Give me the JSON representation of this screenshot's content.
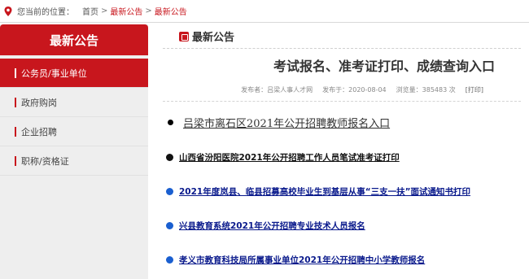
{
  "breadcrumb": {
    "lead": "您当前的位置：",
    "items": [
      "首页",
      "最新公告",
      "最新公告"
    ],
    "separator": ">"
  },
  "sidebar": {
    "title": "最新公告",
    "items": [
      {
        "label": "公务员/事业单位",
        "active": true
      },
      {
        "label": "政府购岗",
        "active": false
      },
      {
        "label": "企业招聘",
        "active": false
      },
      {
        "label": "职称/资格证",
        "active": false
      }
    ]
  },
  "main": {
    "section_title": "最新公告",
    "article_title": "考试报名、准考证打印、成绩查询入口",
    "meta": {
      "publisher": "发布者：吕梁人事人才网",
      "date": "发布于：2020-08-04",
      "views": "浏览量：385483 次",
      "print": "[打印]"
    },
    "first_link": "吕梁市离石区2021年公开招聘教师报名入口",
    "links": [
      {
        "text": "山西省汾阳医院2021年公开招聘工作人员笔试准考证打印",
        "style": "black"
      },
      {
        "text": "2021年度岚县、临县招募高校毕业生到基层从事“三支一扶”面试通知书打印",
        "style": "blue"
      },
      {
        "text": "兴县教育系统2021年公开招聘专业技术人员报名",
        "style": "blue"
      },
      {
        "text": "孝义市教育科技局所属事业单位2021年公开招聘中小学教师报名",
        "style": "blue"
      }
    ]
  },
  "colors": {
    "brand_red": "#c8161d",
    "link_blue": "#0a1a8c",
    "dot_blue": "#1a5fd0"
  }
}
